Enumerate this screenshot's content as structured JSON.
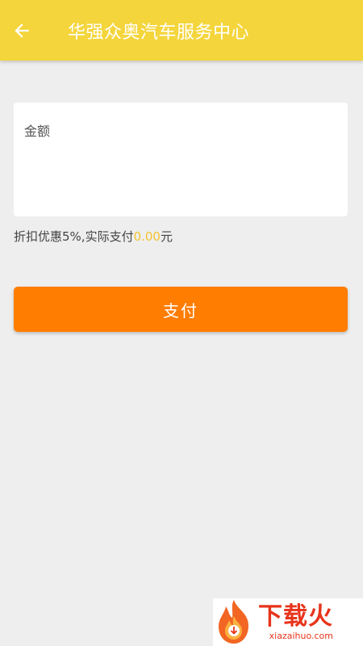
{
  "header": {
    "title": "华强众奥汽车服务中心",
    "back_icon": "arrow-left-icon"
  },
  "amount": {
    "label": "金额",
    "value": "",
    "placeholder": ""
  },
  "discount": {
    "prefix": "折扣优惠5%,实际支付",
    "amount": "0.00",
    "suffix": "元"
  },
  "pay_button": {
    "label": "支付"
  },
  "watermark": {
    "title": "下载火",
    "url": "xiazaihuo.com"
  },
  "colors": {
    "app_bar": "#f4d53b",
    "pay_button": "#ff7d00",
    "discount_amount": "#f4c430",
    "background": "#eeeeee",
    "watermark": "#e8341c"
  }
}
